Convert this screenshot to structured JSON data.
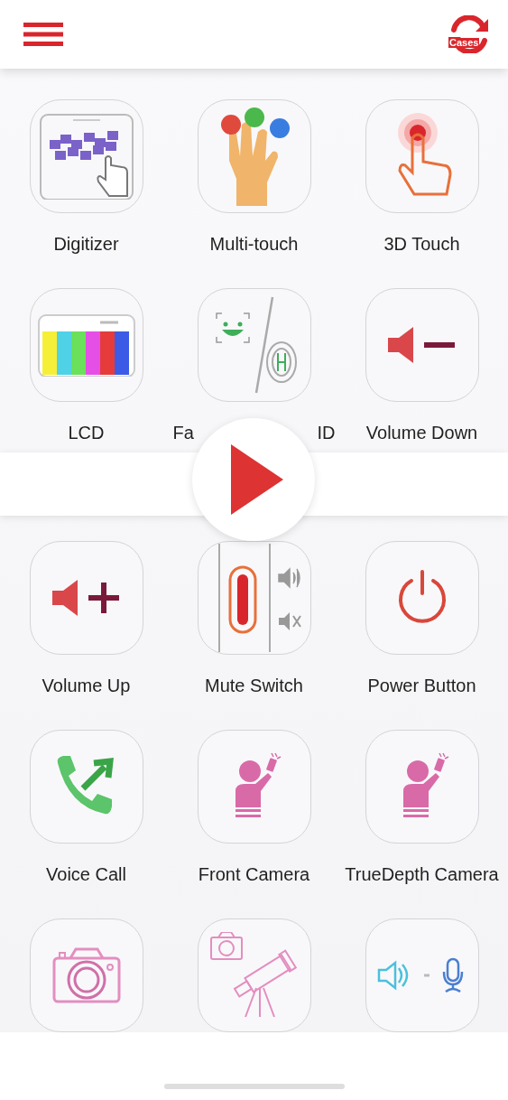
{
  "header": {
    "refresh_label": "Cases"
  },
  "tests_top": [
    {
      "kind": "digitizer",
      "label": "Digitizer"
    },
    {
      "kind": "multi_touch",
      "label": "Multi-touch"
    },
    {
      "kind": "touch_3d",
      "label": "3D Touch"
    },
    {
      "kind": "lcd",
      "label": "LCD"
    },
    {
      "kind": "face_touch_id",
      "label_parts": [
        "Fa",
        "ID"
      ]
    },
    {
      "kind": "volume_down",
      "label": "Volume Down"
    }
  ],
  "video_banner": {
    "kind": "play_button"
  },
  "tests_bottom": [
    {
      "kind": "volume_up",
      "label": "Volume Up"
    },
    {
      "kind": "mute_switch",
      "label": "Mute Switch"
    },
    {
      "kind": "power",
      "label": "Power Button"
    },
    {
      "kind": "voice_call",
      "label": "Voice Call"
    },
    {
      "kind": "front_camera",
      "label": "Front Camera"
    },
    {
      "kind": "truedepth_camera",
      "label": "TrueDepth Camera"
    },
    {
      "kind": "camera"
    },
    {
      "kind": "telescope_camera"
    },
    {
      "kind": "speaker_mic"
    }
  ]
}
